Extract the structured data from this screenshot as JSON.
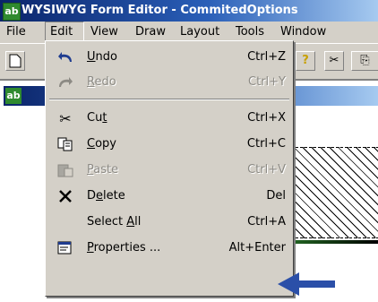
{
  "window": {
    "title": "WYSIWYG Form Editor - CommitedOptions"
  },
  "menubar": {
    "items": [
      "File",
      "Edit",
      "View",
      "Draw",
      "Layout",
      "Tools",
      "Window"
    ],
    "active": "Edit"
  },
  "edit_menu": {
    "items": [
      {
        "label": "Undo",
        "mnemonic": "U",
        "shortcut": "Ctrl+Z",
        "icon": "undo-icon",
        "enabled": true
      },
      {
        "label": "Redo",
        "mnemonic": "R",
        "shortcut": "Ctrl+Y",
        "icon": "redo-icon",
        "enabled": false
      },
      {
        "label": "Cut",
        "mnemonic": "t",
        "shortcut": "Ctrl+X",
        "icon": "scissors-icon",
        "enabled": true
      },
      {
        "label": "Copy",
        "mnemonic": "C",
        "shortcut": "Ctrl+C",
        "icon": "copy-icon",
        "enabled": true
      },
      {
        "label": "Paste",
        "mnemonic": "P",
        "shortcut": "Ctrl+V",
        "icon": "paste-icon",
        "enabled": false
      },
      {
        "label": "Delete",
        "mnemonic": "e",
        "shortcut": "Del",
        "icon": "delete-x-icon",
        "enabled": true
      },
      {
        "label": "Select All",
        "mnemonic": "A",
        "shortcut": "Ctrl+A",
        "icon": "",
        "enabled": true
      },
      {
        "label": "Properties ...",
        "mnemonic": "P",
        "shortcut": "Alt+Enter",
        "icon": "properties-icon",
        "enabled": true
      }
    ]
  },
  "colors": {
    "titlebar_start": "#0a246a",
    "titlebar_end": "#a6caf0",
    "menu_bg": "#d4d0c8",
    "disabled_text": "#8c8a84",
    "annotation_arrow": "#2b4fa8"
  }
}
